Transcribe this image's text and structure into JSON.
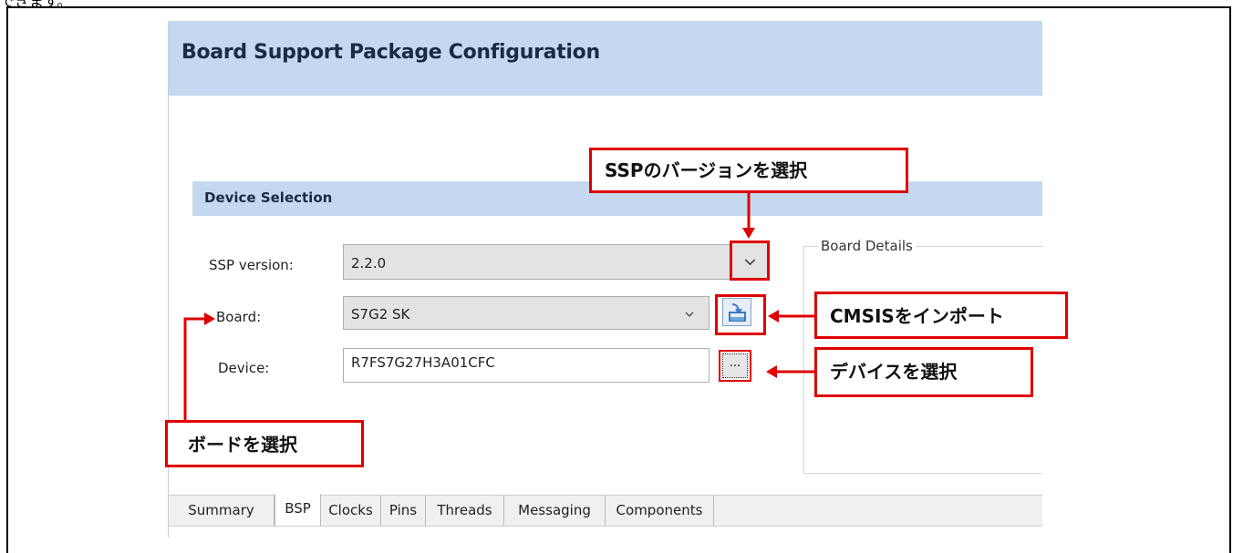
{
  "top_text": "できます。",
  "window": {
    "title": "Board Support Package Configuration"
  },
  "device_selection": {
    "section_title": "Device Selection",
    "ssp_version": {
      "label": "SSP version:",
      "value": "2.2.0"
    },
    "board": {
      "label": "Board:",
      "value": "S7G2 SK"
    },
    "device": {
      "label": "Device:",
      "value": "R7FS7G27H3A01CFC"
    },
    "browse_button_label": "...",
    "board_details_title": "Board Details"
  },
  "tabs": [
    {
      "label": "Summary"
    },
    {
      "label": "BSP",
      "active": true
    },
    {
      "label": "Clocks"
    },
    {
      "label": "Pins"
    },
    {
      "label": "Threads"
    },
    {
      "label": "Messaging"
    },
    {
      "label": "Components"
    }
  ],
  "annotations": {
    "select_ssp_version": "SSPのバージョンを選択",
    "import_cmsis": "CMSISをインポート",
    "select_device": "デバイスを選択",
    "select_board": "ボードを選択"
  },
  "colors": {
    "header_band": "#c4d9ef",
    "annotation_red": "#e00000"
  },
  "icons": {
    "import": "import-icon",
    "dropdown": "chevron-down-icon"
  }
}
